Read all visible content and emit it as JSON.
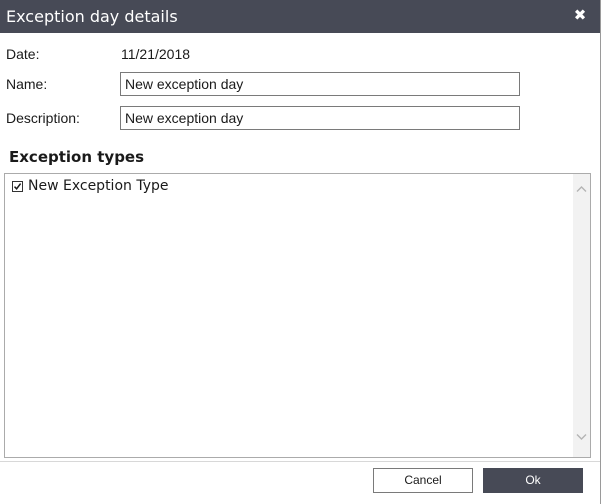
{
  "dialog": {
    "title": "Exception day details",
    "close_icon": "close-icon",
    "colors": {
      "titlebar": "#474a56",
      "primary_button": "#474a56"
    }
  },
  "form": {
    "date_label": "Date:",
    "date_value": "11/21/2018",
    "name_label": "Name:",
    "name_value": "New exception day",
    "description_label": "Description:",
    "description_value": "New exception day"
  },
  "exception_types": {
    "title": "Exception types",
    "items": [
      {
        "label": "New Exception Type",
        "checked": true
      }
    ]
  },
  "footer": {
    "cancel_label": "Cancel",
    "ok_label": "Ok"
  }
}
